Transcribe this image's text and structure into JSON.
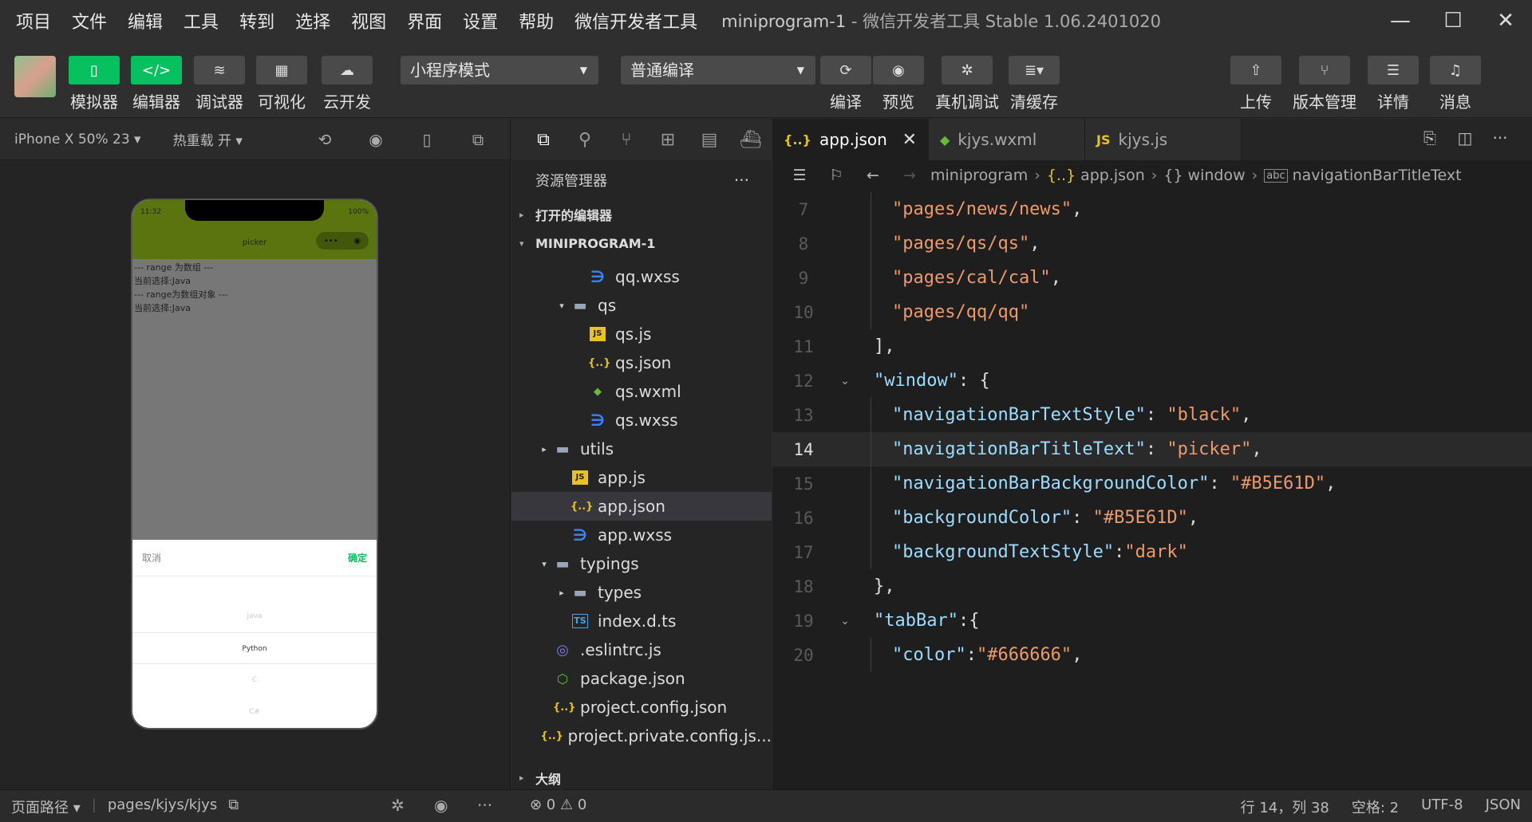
{
  "menubar": {
    "items": [
      "项目",
      "文件",
      "编辑",
      "工具",
      "转到",
      "选择",
      "视图",
      "界面",
      "设置",
      "帮助",
      "微信开发者工具"
    ],
    "project": "miniprogram-1",
    "app_title": " - 微信开发者工具 Stable 1.06.2401020"
  },
  "toolbar": {
    "simulator": "模拟器",
    "editor": "编辑器",
    "debugger": "调试器",
    "visual": "可视化",
    "cloud": "云开发",
    "mode_select": "小程序模式",
    "compile_select": "普通编译",
    "compile": "编译",
    "preview": "预览",
    "real_debug": "真机调试",
    "clear_cache": "清缓存",
    "upload": "上传",
    "version": "版本管理",
    "details": "详情",
    "messages": "消息"
  },
  "simulator": {
    "device": "iPhone X 50% 23 ▾",
    "hot_reload": "热重载 开 ▾",
    "phone": {
      "time": "11:32",
      "battery": "100%",
      "title": "picker",
      "lines": [
        "--- range 为数组 ---",
        "当前选择:Java",
        "--- range为数组对象 ---",
        "当前选择:Java"
      ],
      "cancel": "取消",
      "confirm": "确定",
      "options": [
        "Java",
        "Python",
        "C",
        "C#"
      ]
    }
  },
  "explorer": {
    "title": "资源管理器",
    "open_editors": "打开的编辑器",
    "project": "MINIPROGRAM-1",
    "outline": "大纲",
    "files": [
      {
        "name": "qq.wxss",
        "type": "css",
        "indent": 3,
        "twisty": ""
      },
      {
        "name": "qs",
        "type": "folder",
        "indent": 2,
        "twisty": "▾"
      },
      {
        "name": "qs.js",
        "type": "js",
        "indent": 3,
        "twisty": ""
      },
      {
        "name": "qs.json",
        "type": "json",
        "indent": 3,
        "twisty": ""
      },
      {
        "name": "qs.wxml",
        "type": "wxml",
        "indent": 3,
        "twisty": ""
      },
      {
        "name": "qs.wxss",
        "type": "css",
        "indent": 3,
        "twisty": ""
      },
      {
        "name": "utils",
        "type": "folder",
        "indent": 1,
        "twisty": "▸"
      },
      {
        "name": "app.js",
        "type": "js",
        "indent": 2,
        "twisty": ""
      },
      {
        "name": "app.json",
        "type": "json",
        "indent": 2,
        "twisty": "",
        "selected": true
      },
      {
        "name": "app.wxss",
        "type": "css",
        "indent": 2,
        "twisty": ""
      },
      {
        "name": "typings",
        "type": "folder",
        "indent": 1,
        "twisty": "▾"
      },
      {
        "name": "types",
        "type": "folder",
        "indent": 2,
        "twisty": "▸"
      },
      {
        "name": "index.d.ts",
        "type": "ts",
        "indent": 2,
        "twisty": ""
      },
      {
        "name": ".eslintrc.js",
        "type": "eslint",
        "indent": 1,
        "twisty": ""
      },
      {
        "name": "package.json",
        "type": "node",
        "indent": 1,
        "twisty": ""
      },
      {
        "name": "project.config.json",
        "type": "json",
        "indent": 1,
        "twisty": ""
      },
      {
        "name": "project.private.config.js...",
        "type": "json",
        "indent": 1,
        "twisty": ""
      }
    ]
  },
  "editor": {
    "tabs": [
      {
        "name": "app.json",
        "icon": "{..}",
        "active": true
      },
      {
        "name": "kjys.wxml",
        "icon": "◆",
        "active": false
      },
      {
        "name": "kjys.js",
        "icon": "JS",
        "active": false
      }
    ],
    "breadcrumb": [
      "miniprogram",
      "app.json",
      "window",
      "navigationBarTitleText"
    ],
    "current_line": 14,
    "lines": [
      {
        "n": "7",
        "indent": 2,
        "tokens": [
          [
            "s",
            "\"pages/news/news\""
          ],
          [
            "p",
            ","
          ]
        ]
      },
      {
        "n": "8",
        "indent": 2,
        "tokens": [
          [
            "s",
            "\"pages/qs/qs\""
          ],
          [
            "p",
            ","
          ]
        ]
      },
      {
        "n": "9",
        "indent": 2,
        "tokens": [
          [
            "s",
            "\"pages/cal/cal\""
          ],
          [
            "p",
            ","
          ]
        ]
      },
      {
        "n": "10",
        "indent": 2,
        "tokens": [
          [
            "s",
            "\"pages/qq/qq\""
          ]
        ]
      },
      {
        "n": "11",
        "indent": 1,
        "tokens": [
          [
            "p",
            "],"
          ]
        ]
      },
      {
        "n": "12",
        "indent": 1,
        "fold": true,
        "tokens": [
          [
            "k",
            "\"window\""
          ],
          [
            "p",
            ": {"
          ]
        ]
      },
      {
        "n": "13",
        "indent": 2,
        "tokens": [
          [
            "k",
            "\"navigationBarTextStyle\""
          ],
          [
            "p",
            ": "
          ],
          [
            "s",
            "\"black\""
          ],
          [
            "p",
            ","
          ]
        ]
      },
      {
        "n": "14",
        "indent": 2,
        "tokens": [
          [
            "k",
            "\"navigationBarTitleText\""
          ],
          [
            "p",
            ": "
          ],
          [
            "s",
            "\"picker\""
          ],
          [
            "p",
            ","
          ]
        ]
      },
      {
        "n": "15",
        "indent": 2,
        "tokens": [
          [
            "k",
            "\"navigationBarBackgroundColor\""
          ],
          [
            "p",
            ": "
          ],
          [
            "s",
            "\"#B5E61D\""
          ],
          [
            "p",
            ","
          ]
        ]
      },
      {
        "n": "16",
        "indent": 2,
        "tokens": [
          [
            "k",
            "\"backgroundColor\""
          ],
          [
            "p",
            ": "
          ],
          [
            "s",
            "\"#B5E61D\""
          ],
          [
            "p",
            ","
          ]
        ]
      },
      {
        "n": "17",
        "indent": 2,
        "tokens": [
          [
            "k",
            "\"backgroundTextStyle\""
          ],
          [
            "p",
            ":"
          ],
          [
            "s",
            "\"dark\""
          ]
        ]
      },
      {
        "n": "18",
        "indent": 1,
        "tokens": [
          [
            "p",
            "},"
          ]
        ]
      },
      {
        "n": "19",
        "indent": 1,
        "fold": true,
        "tokens": [
          [
            "k",
            "\"tabBar\""
          ],
          [
            "p",
            ":{"
          ]
        ]
      },
      {
        "n": "20",
        "indent": 2,
        "tokens": [
          [
            "k",
            "\"color\""
          ],
          [
            "p",
            ":"
          ],
          [
            "s",
            "\"#666666\""
          ],
          [
            "p",
            ","
          ]
        ]
      }
    ]
  },
  "statusbar": {
    "page_path": "页面路径 ▾",
    "path": "pages/kjys/kjys",
    "problems": "⊗ 0 ⚠ 0",
    "position": "行 14，列 38",
    "spaces": "空格: 2",
    "encoding": "UTF-8",
    "language": "JSON"
  }
}
